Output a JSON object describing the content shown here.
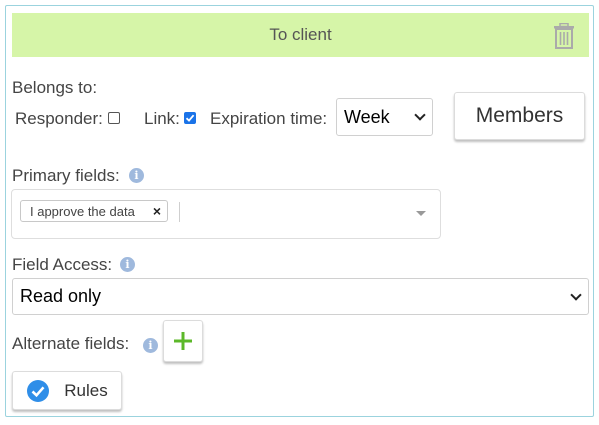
{
  "header": {
    "title": "To client",
    "delete_icon": "trash-icon"
  },
  "belongs": {
    "label": "Belongs to:",
    "responder_label": "Responder:",
    "responder_checked": false,
    "link_label": "Link:",
    "link_checked": true,
    "expiration_label": "Expiration time:",
    "expiration_value": "Week",
    "members_label": "Members"
  },
  "primary": {
    "label": "Primary fields:",
    "info_icon": "info-icon",
    "tags": [
      "I approve the data"
    ]
  },
  "access": {
    "label": "Field Access:",
    "info_icon": "info-icon",
    "value": "Read only"
  },
  "alternate": {
    "label": "Alternate fields:",
    "info_icon": "info-icon",
    "add_icon": "plus-icon"
  },
  "rules": {
    "label": "Rules",
    "icon": "check-circle-icon"
  },
  "colors": {
    "header_bg": "#d6f5a8",
    "panel_border": "#9bd3de",
    "checkbox_accent": "#1a73e8",
    "plus_green": "#5cb82a",
    "rules_icon_blue": "#2f8ee8",
    "info_icon_bg": "#9fb9dd"
  }
}
